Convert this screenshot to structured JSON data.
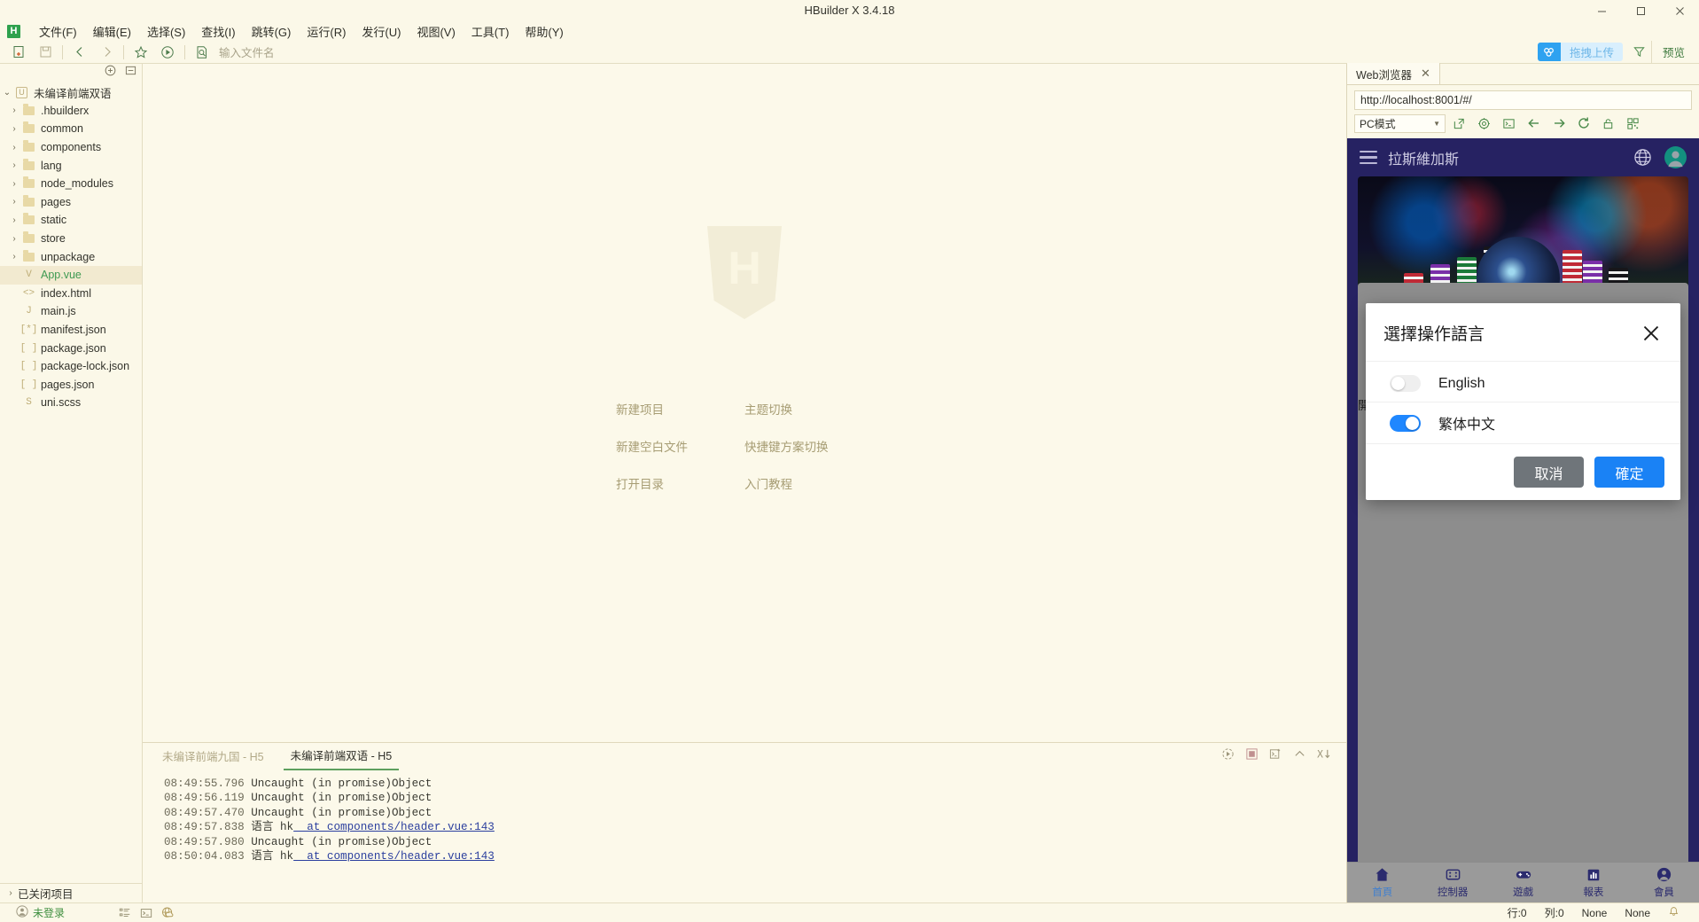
{
  "window": {
    "title": "HBuilder X 3.4.18",
    "minimize": "minimize-button",
    "maximize": "maximize-button",
    "close": "close-button"
  },
  "menubar": {
    "logo": "H",
    "items": [
      "文件(F)",
      "编辑(E)",
      "选择(S)",
      "查找(I)",
      "跳转(G)",
      "运行(R)",
      "发行(U)",
      "视图(V)",
      "工具(T)",
      "帮助(Y)"
    ]
  },
  "toolbar": {
    "filename_placeholder": "输入文件名",
    "upload_label": "拖拽上传",
    "preview_label": "预览"
  },
  "sidebar": {
    "project": "未编译前端双语",
    "closed_projects": "已关闭项目",
    "items": [
      {
        "label": ".hbuilderx",
        "type": "folder",
        "depth": 1
      },
      {
        "label": "common",
        "type": "folder",
        "depth": 1
      },
      {
        "label": "components",
        "type": "folder",
        "depth": 1
      },
      {
        "label": "lang",
        "type": "folder",
        "depth": 1
      },
      {
        "label": "node_modules",
        "type": "folder",
        "depth": 1
      },
      {
        "label": "pages",
        "type": "folder",
        "depth": 1
      },
      {
        "label": "static",
        "type": "folder",
        "depth": 1
      },
      {
        "label": "store",
        "type": "folder",
        "depth": 1
      },
      {
        "label": "unpackage",
        "type": "folder",
        "depth": 1
      },
      {
        "label": "App.vue",
        "type": "vue",
        "depth": 1,
        "selected": true
      },
      {
        "label": "index.html",
        "type": "html",
        "depth": 1
      },
      {
        "label": "main.js",
        "type": "js",
        "depth": 1
      },
      {
        "label": "manifest.json",
        "type": "cfg",
        "depth": 1
      },
      {
        "label": "package.json",
        "type": "json",
        "depth": 1
      },
      {
        "label": "package-lock.json",
        "type": "json",
        "depth": 1
      },
      {
        "label": "pages.json",
        "type": "json",
        "depth": 1
      },
      {
        "label": "uni.scss",
        "type": "scss",
        "depth": 1
      }
    ]
  },
  "welcome": {
    "logo_letter": "H",
    "links": [
      "新建项目",
      "主题切换",
      "新建空白文件",
      "快捷键方案切换",
      "打开目录",
      "入门教程"
    ]
  },
  "console": {
    "tabs": [
      {
        "label": "未编译前端九国 - H5",
        "active": false
      },
      {
        "label": "未编译前端双语 - H5",
        "active": true
      }
    ],
    "lines": [
      {
        "ts": "08:49:55.796",
        "text": "Uncaught (in promise)Object",
        "link": ""
      },
      {
        "ts": "08:49:56.119",
        "text": "Uncaught (in promise)Object",
        "link": ""
      },
      {
        "ts": "08:49:57.470",
        "text": "Uncaught (in promise)Object",
        "link": ""
      },
      {
        "ts": "08:49:57.838",
        "text": "语言 hk",
        "link": "at components/header.vue:143"
      },
      {
        "ts": "08:49:57.980",
        "text": "Uncaught (in promise)Object",
        "link": ""
      },
      {
        "ts": "08:50:04.083",
        "text": "语言 hk",
        "link": "at components/header.vue:143"
      }
    ]
  },
  "browser": {
    "tab_label": "Web浏览器",
    "url": "http://localhost:8001/#/",
    "mode": "PC模式"
  },
  "app": {
    "title": "拉斯維加斯",
    "section_label": "開獎記錄",
    "tabbar": [
      {
        "label": "首頁",
        "icon": "home-icon",
        "active": true
      },
      {
        "label": "控制器",
        "icon": "controller-icon",
        "active": false
      },
      {
        "label": "遊戲",
        "icon": "gamepad-icon",
        "active": false
      },
      {
        "label": "報表",
        "icon": "chart-icon",
        "active": false
      },
      {
        "label": "會員",
        "icon": "user-icon",
        "active": false
      }
    ]
  },
  "modal": {
    "title": "選擇操作語言",
    "close_icon": "close-icon",
    "languages": [
      {
        "name": "English",
        "on": false
      },
      {
        "name": "繁体中文",
        "on": true
      }
    ],
    "cancel_label": "取消",
    "confirm_label": "確定"
  },
  "statusbar": {
    "login": "未登录",
    "row": "行:0",
    "col": "列:0",
    "encoding": "None",
    "language": "None"
  },
  "colors": {
    "app_bg": "#fbf8e8",
    "accent_green": "#3f8f3f",
    "brand_navy": "#262262",
    "switch_on": "#1f87ff",
    "confirm_blue": "#1a82f5",
    "cancel_grey": "#6f757a"
  }
}
